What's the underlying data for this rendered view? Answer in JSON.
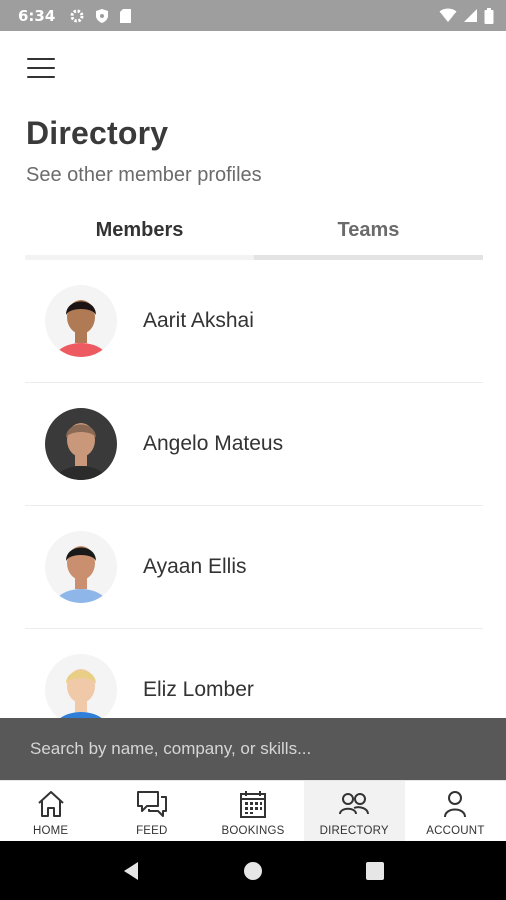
{
  "status_bar": {
    "time": "6:34"
  },
  "header": {
    "title": "Directory",
    "subtitle": "See other member profiles"
  },
  "tabs": [
    {
      "label": "Members",
      "active": true
    },
    {
      "label": "Teams",
      "active": false
    }
  ],
  "members": [
    {
      "name": "Aarit Akshai",
      "avatar_icon": "person-avatar",
      "bg": "#f4f4f4",
      "skin": "#b07a55",
      "hair": "#1c1414",
      "shirt": "#ee5a62"
    },
    {
      "name": "Angelo Mateus",
      "avatar_icon": "person-avatar",
      "bg": "#3a3a3a",
      "skin": "#c9977a",
      "hair": "#8a6a55",
      "shirt": "#2b2b2b"
    },
    {
      "name": "Ayaan Ellis",
      "avatar_icon": "person-avatar",
      "bg": "#f4f4f4",
      "skin": "#c98f6e",
      "hair": "#1a1a1a",
      "shirt": "#8fb6e8"
    },
    {
      "name": "Eliz Lomber",
      "avatar_icon": "person-avatar",
      "bg": "#f4f4f4",
      "skin": "#f0c9a8",
      "hair": "#e9cf85",
      "shirt": "#2f7fd8"
    }
  ],
  "search": {
    "placeholder": "Search by name, company, or skills..."
  },
  "bottom_nav": [
    {
      "label": "HOME",
      "icon": "home-icon",
      "active": false
    },
    {
      "label": "FEED",
      "icon": "chat-bubbles-icon",
      "active": false
    },
    {
      "label": "BOOKINGS",
      "icon": "calendar-icon",
      "active": false
    },
    {
      "label": "DIRECTORY",
      "icon": "people-icon",
      "active": true
    },
    {
      "label": "ACCOUNT",
      "icon": "person-icon",
      "active": false
    }
  ],
  "colors": {
    "status_bar": "#9e9e9e",
    "search_bar": "#585858",
    "active_nav_bg": "#f2f2f2"
  }
}
